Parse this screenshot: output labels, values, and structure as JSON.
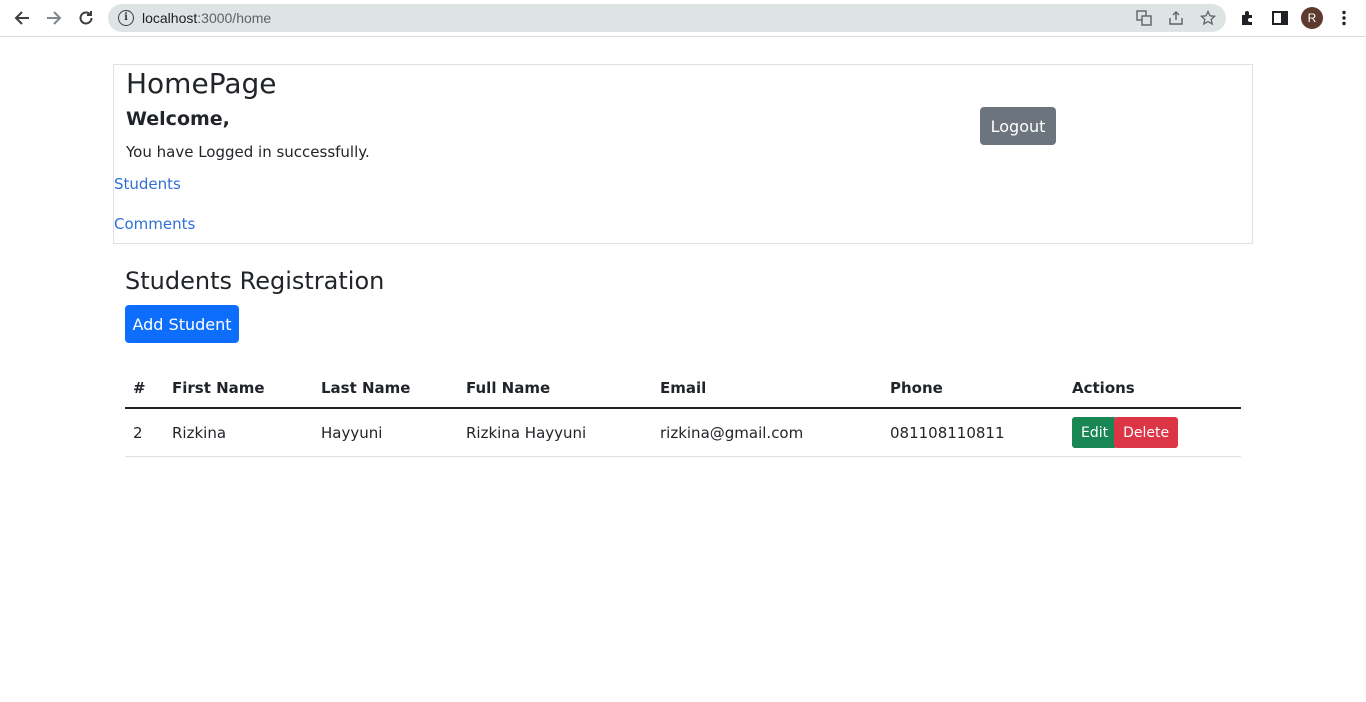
{
  "browser": {
    "url_host": "localhost",
    "url_path": ":3000/home",
    "avatar_letter": "R"
  },
  "home": {
    "title": "HomePage",
    "welcome": "Welcome,",
    "message": "You have Logged in successfully.",
    "links": [
      "Students",
      "Comments"
    ],
    "logout_label": "Logout"
  },
  "students": {
    "title": "Students Registration",
    "add_label": "Add Student",
    "columns": [
      "#",
      "First Name",
      "Last Name",
      "Full Name",
      "Email",
      "Phone",
      "Actions"
    ],
    "rows": [
      {
        "id": "2",
        "first_name": "Rizkina",
        "last_name": "Hayyuni",
        "full_name": "Rizkina Hayyuni",
        "email": "rizkina@gmail.com",
        "phone": "081108110811",
        "edit_label": "Edit",
        "delete_label": "Delete"
      }
    ]
  },
  "colors": {
    "primary": "#0d6efd",
    "secondary": "#6c757d",
    "success": "#198754",
    "danger": "#dc3545",
    "link": "#2f6fd6"
  }
}
